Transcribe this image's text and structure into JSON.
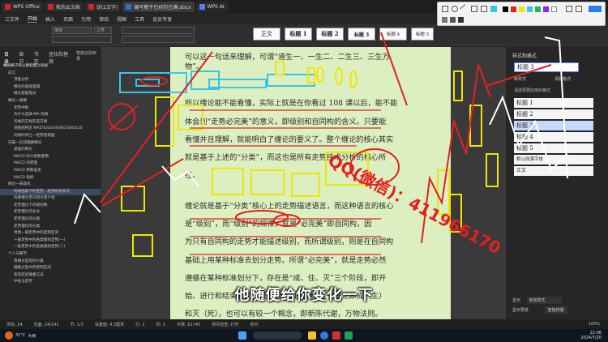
{
  "titlebar": {
    "tabs": [
      {
        "label": "WPS Office",
        "icon": "wps-icon"
      },
      {
        "label": "我的云文档",
        "icon": "cloud-doc-icon"
      },
      {
        "label": "话(2文字)",
        "icon": "wps-icon"
      },
      {
        "label": "编写教子已经的已满.docx",
        "icon": "doc-icon"
      },
      {
        "label": "WPS AI",
        "icon": "ai-icon"
      }
    ]
  },
  "menubar": {
    "items": [
      "三文件",
      "开始",
      "插入",
      "页面",
      "引用",
      "审阅",
      "视图",
      "工具",
      "会员专享"
    ],
    "selected": "开始"
  },
  "ribbon": {
    "font_name": "宋体",
    "font_size": "三号",
    "styles": [
      "正文",
      "标题 1",
      "标题 2",
      "标题 3",
      "标题 4",
      "标题 5"
    ]
  },
  "left_panel": {
    "tabs": [
      "目录",
      "章节",
      "书签",
      "查找和替换"
    ],
    "action": "智能识别目录",
    "items": [
      {
        "label": "缠论教子和公教程集之目录",
        "level": 1
      },
      {
        "label": "前言",
        "level": 2
      },
      {
        "label": "顶底分析",
        "level": 3
      },
      {
        "label": "缠论的基础逻辑",
        "level": 3
      },
      {
        "label": "缠论基础理论",
        "level": 3
      },
      {
        "label": "缠论一线缠",
        "level": 2
      },
      {
        "label": "走势中枢",
        "level": 3
      },
      {
        "label": "为什么选择 MA 均线",
        "level": 3
      },
      {
        "label": "均线的交易形态交情",
        "level": 3
      },
      {
        "label": "顶底结构区 MA5/10/20/40/60/100/120",
        "level": 3
      },
      {
        "label": "均线时间之一走势结构图",
        "level": 3
      },
      {
        "label": "开篇一信仰理解缠论",
        "level": 2
      },
      {
        "label": "基础的缠论",
        "level": 3
      },
      {
        "label": "MACD 的介绍和使用",
        "level": 3
      },
      {
        "label": "MACD 的原理",
        "level": 3
      },
      {
        "label": "MACD 参数设定",
        "level": 3
      },
      {
        "label": "MACD 指标",
        "level": 3
      },
      {
        "label": "缠论一真成式",
        "level": 2
      },
      {
        "label": "均线强弱下的走势、趋势的买卖点",
        "level": 3,
        "highlight": true
      },
      {
        "label": "仿佛缠论至升和大家介绍",
        "level": 3
      },
      {
        "label": "走势理论下的级别情",
        "level": 3
      },
      {
        "label": "走势理论的生长",
        "level": 3
      },
      {
        "label": "走势理论的分类",
        "level": 3
      },
      {
        "label": "走势理论的分类",
        "level": 3
      },
      {
        "label": "另类一级走势中的结构区间",
        "level": 3
      },
      {
        "label": "一般走势中的各类级别走势(一)",
        "level": 3
      },
      {
        "label": "一般走势中的各类级别走势(二)",
        "level": 3
      },
      {
        "label": "个人与细节",
        "level": 2
      },
      {
        "label": "策略分型及的小级",
        "level": 3
      },
      {
        "label": "理解分型中的结构区间",
        "level": 3
      },
      {
        "label": "笔的区间要素方法",
        "level": 3
      },
      {
        "label": "中枢与走势",
        "level": 3
      }
    ]
  },
  "document": {
    "lines": [
      "可以这一句话来理解，可谓“道生一、一生二、二生三、三生万",
      "物”。",
      "所以缠论能不能看懂，实际上就是在你看过 108 课以后，能不能",
      "体会到“走势必完美”的意义，即级别和自同构的含义。只要能",
      "看懂并且理解，就能明白了缠论的要义了。整个缠论的核心其实",
      "就是基于上述的“分类”，而这也是所有走势技术分析的核心所",
      "在。",
      "缠论就是基于“分类”核心上的走势描述语言，而这种语言的核心",
      "是“级别”，而“级别”的规律，就是“必完美”即自同构，因",
      "为只有自同构的走势才能描述级别，而所谓级别，则是在自同构",
      "基础上用某种标准去划分走势。所谓“必完美”，就是走势必然",
      "遵循在某种标准划分下，存在是“成、住、灭”三个阶段，即开",
      "始、进行和结束三个阶段。“走势必完美”这一理论即成（生）",
      "和灭（死），也可以有较一个概念，即新陈代谢，万物法则。"
    ],
    "overlay_text": "QQ(微信)：411966170",
    "caption": "他随便给你变化一下"
  },
  "right_panel": {
    "title": "样式和格式",
    "current_style": "标题 3",
    "new_style_label": "新样式",
    "clear_label": "清除格式",
    "list_label": "请选择要应用的格式",
    "styles": [
      "标题 1",
      "标题 2",
      "标题 3",
      "标题 4",
      "标题 5",
      "默认段落字体",
      "正文"
    ],
    "selected": "标题 3",
    "show_label": "显示",
    "show_value": "有效样式",
    "preview_label": "显示预览",
    "smart_label": "智能排版"
  },
  "statusbar": {
    "items": [
      "页码: 24",
      "页面: 24/141",
      "节: 1/1",
      "设置值: 4.3厘米",
      "行: 1",
      "列: 1",
      "字数: 61745",
      "拼写检查: 打开",
      "校对"
    ],
    "zoom": "100%"
  },
  "taskbar": {
    "temp": "31°C",
    "weather": "大雨",
    "time": "22:06",
    "date": "2024/7/20"
  },
  "colors": {
    "page_bg": "#dcefc0",
    "annotation_red": "#e32020",
    "annotation_yellow": "#f2e600",
    "annotation_cyan": "#37c7e6"
  }
}
